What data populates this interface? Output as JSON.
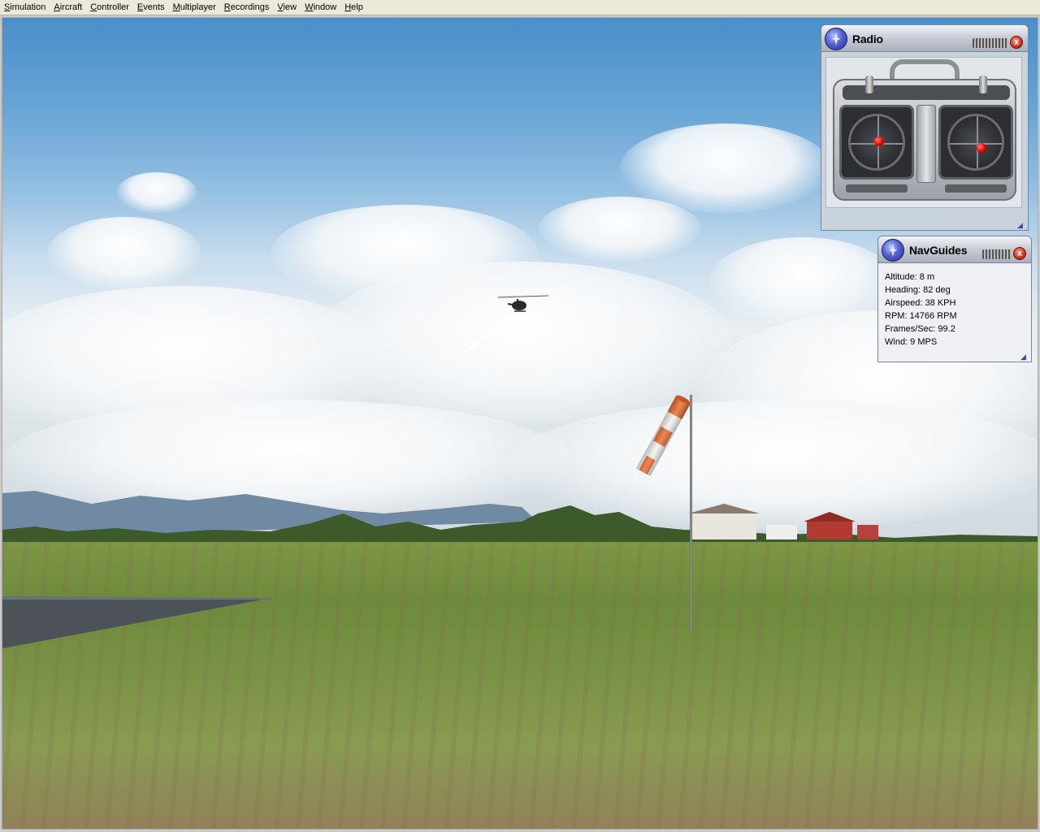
{
  "menu": {
    "items": [
      "Simulation",
      "Aircraft",
      "Controller",
      "Events",
      "Multiplayer",
      "Recordings",
      "View",
      "Window",
      "Help"
    ]
  },
  "radio_window": {
    "title": "Radio",
    "close_label": "x"
  },
  "nav_window": {
    "title": "NavGuides",
    "close_label": "x",
    "lines": [
      "Altitude: 8 m",
      "Heading: 82 deg",
      "Airspeed: 38 KPH",
      "RPM: 14766 RPM",
      "Frames/Sec: 99.2",
      "Wind: 9 MPS"
    ]
  },
  "colors": {
    "menubar": "#ece9d8",
    "sky_top": "#4a8ec9",
    "grass": "#7a9245",
    "windsock_orange": "#e8672a",
    "stick_red": "#e00000"
  },
  "icons": {
    "window_globe": "globe-icon",
    "close": "close-icon",
    "resize": "resize-grip-icon"
  }
}
